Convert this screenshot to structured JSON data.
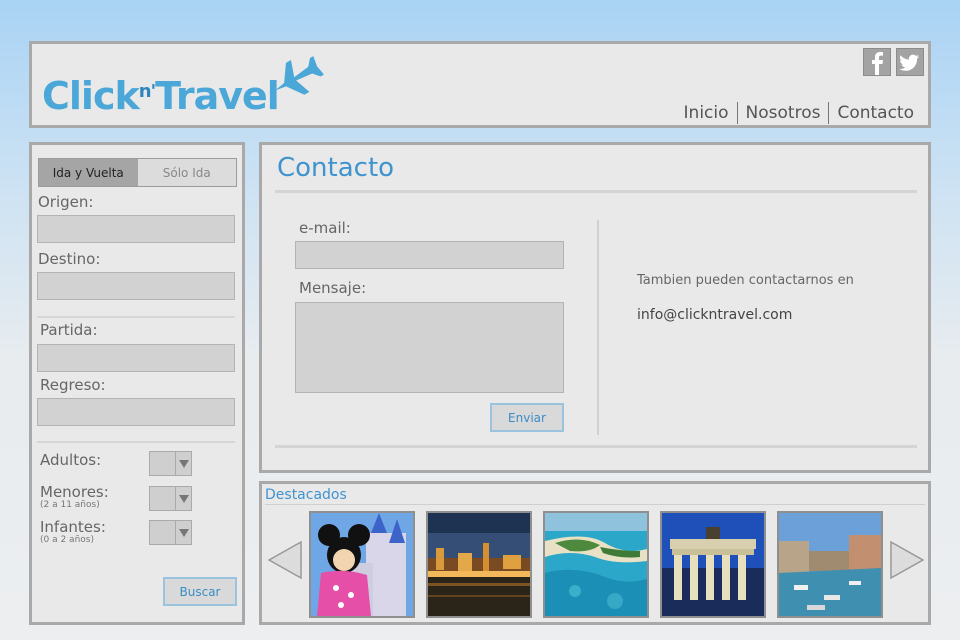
{
  "header": {
    "logo": {
      "text_main": "Click",
      "text_small": "n'",
      "text_end": "Travel"
    },
    "social": [
      {
        "name": "facebook",
        "icon": "facebook-icon"
      },
      {
        "name": "twitter",
        "icon": "twitter-icon"
      }
    ],
    "nav": [
      "Inicio",
      "Nosotros",
      "Contacto"
    ]
  },
  "sidebar": {
    "tabs": {
      "round_trip": "Ida y Vuelta",
      "one_way": "Sólo Ida",
      "selected": "Ida y Vuelta"
    },
    "origin_label": "Origen:",
    "destination_label": "Destino:",
    "departure_label": "Partida:",
    "return_label": "Regreso:",
    "adults_label": "Adultos:",
    "children_label": "Menores:",
    "children_note": "(2 a 11 años)",
    "infants_label": "Infantes:",
    "infants_note": "(0 a 2 años)",
    "search_button": "Buscar"
  },
  "contact": {
    "title": "Contacto",
    "email_label": "e-mail:",
    "message_label": "Mensaje:",
    "send_button": "Enviar",
    "info_text": "Tambien pueden contactarnos en",
    "info_email": "info@clickntravel.com"
  },
  "featured": {
    "title": "Destacados",
    "items": [
      {
        "name": "disney-castle",
        "icon": "photo"
      },
      {
        "name": "city-night",
        "icon": "photo"
      },
      {
        "name": "tropical-island",
        "icon": "photo"
      },
      {
        "name": "brandenburg-gate",
        "icon": "photo"
      },
      {
        "name": "venice-canal",
        "icon": "photo"
      }
    ]
  },
  "colors": {
    "accent": "#3f93cf",
    "panel_bg": "#e9e9e9",
    "panel_border": "#a9a9a9"
  }
}
